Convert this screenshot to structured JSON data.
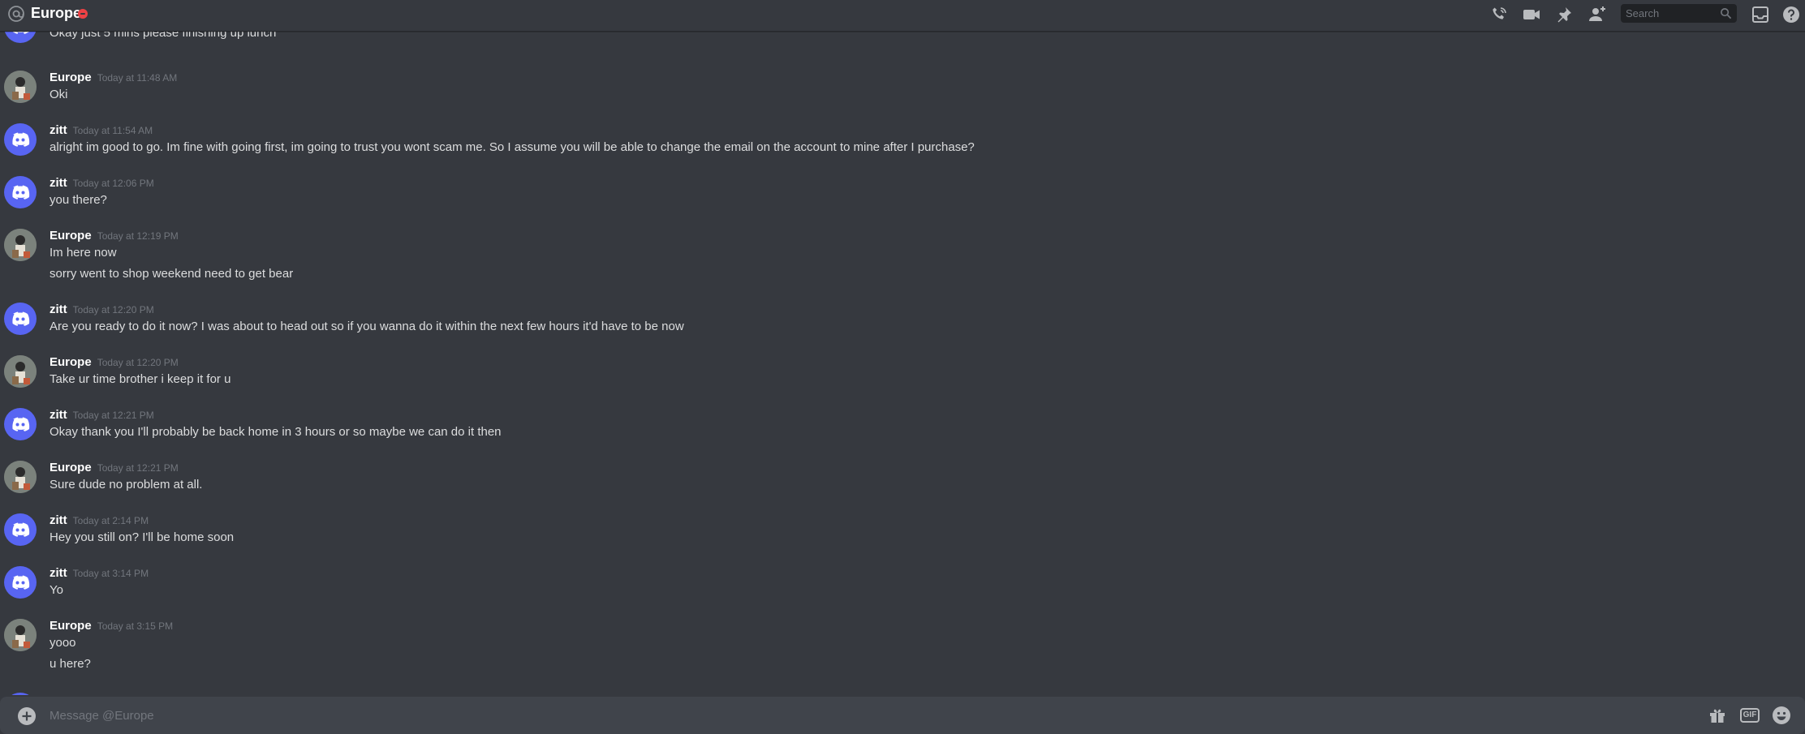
{
  "header": {
    "channel_name": "Europe",
    "search_placeholder": "Search",
    "icons": [
      "at-sign-icon",
      "dnd-status-icon",
      "start-voice-call-icon",
      "start-video-call-icon",
      "pinned-messages-icon",
      "add-friends-to-dm-icon",
      "search-icon",
      "inbox-icon",
      "help-icon"
    ]
  },
  "messages": [
    {
      "author": "",
      "time": "",
      "lines": [
        "Okay just 5 mins please finishing up lunch"
      ]
    },
    {
      "author": "Europe",
      "time": "Today at 11:48 AM",
      "lines": [
        "Oki"
      ]
    },
    {
      "author": "zitt",
      "time": "Today at 11:54 AM",
      "lines": [
        "alright im good to go. Im fine with going first, im going to trust you wont scam me. So I assume you will be able to change the email on the account to mine after I purchase?"
      ]
    },
    {
      "author": "zitt",
      "time": "Today at 12:06 PM",
      "lines": [
        "you there?"
      ]
    },
    {
      "author": "Europe",
      "time": "Today at 12:19 PM",
      "lines": [
        "Im here now",
        "sorry went to shop weekend need to get bear"
      ]
    },
    {
      "author": "zitt",
      "time": "Today at 12:20 PM",
      "lines": [
        "Are you ready to do it now? I was about to head out so if you wanna do it within the next few hours it'd have to be now"
      ]
    },
    {
      "author": "Europe",
      "time": "Today at 12:20 PM",
      "lines": [
        "Take ur time brother i keep it for u"
      ]
    },
    {
      "author": "zitt",
      "time": "Today at 12:21 PM",
      "lines": [
        "Okay thank you I'll probably be back home in 3 hours or so maybe we can do it then"
      ]
    },
    {
      "author": "Europe",
      "time": "Today at 12:21 PM",
      "lines": [
        "Sure dude no problem at all."
      ]
    },
    {
      "author": "zitt",
      "time": "Today at 2:14 PM",
      "lines": [
        "Hey you still on? I'll be home soon"
      ]
    },
    {
      "author": "zitt",
      "time": "Today at 3:14 PM",
      "lines": [
        "Yo"
      ]
    },
    {
      "author": "Europe",
      "time": "Today at 3:15 PM",
      "lines": [
        "yooo",
        "u here?"
      ]
    }
  ],
  "composer": {
    "placeholder": "Message @Europe",
    "icons": [
      "attach-plus-icon",
      "gift-icon",
      "gif-icon",
      "emoji-icon"
    ]
  },
  "colors": {
    "background": "#36393f",
    "blurple": "#5865f2",
    "dnd_red": "#ed4245",
    "composer": "#40444b"
  }
}
